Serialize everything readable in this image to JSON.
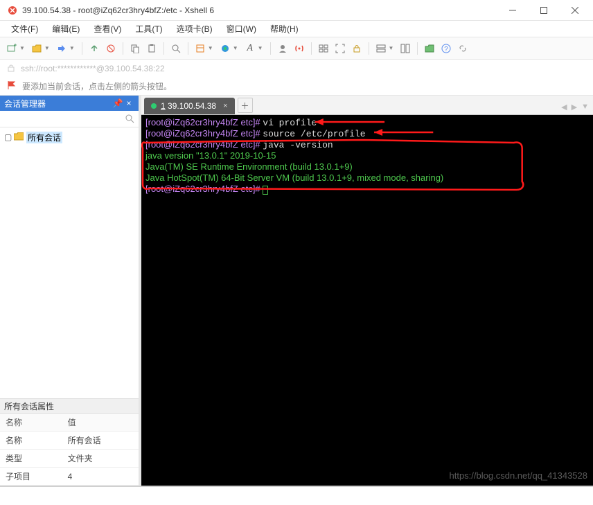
{
  "titlebar": {
    "title": "39.100.54.38 - root@iZq62cr3hry4bfZ:/etc - Xshell 6"
  },
  "menubar": {
    "file": "文件(F)",
    "edit": "编辑(E)",
    "view": "查看(V)",
    "tools": "工具(T)",
    "tabs": "选项卡(B)",
    "window": "窗口(W)",
    "help": "帮助(H)"
  },
  "addressbar": {
    "text": "ssh://root:************@39.100.54.38:22"
  },
  "notify": {
    "text": "要添加当前会话，点击左侧的箭头按钮。"
  },
  "sidebar": {
    "title": "会话管理器",
    "tree": {
      "root_label": "所有会话"
    },
    "props_title": "所有会话属性",
    "props_headers": {
      "name": "名称",
      "value": "值"
    },
    "props_rows": [
      {
        "k": "名称",
        "v": "所有会话"
      },
      {
        "k": "类型",
        "v": "文件夹"
      },
      {
        "k": "子项目",
        "v": "4"
      }
    ]
  },
  "main": {
    "tab": {
      "num": "1",
      "label": "39.100.54.38"
    },
    "terminal": {
      "lines": [
        {
          "prompt": "[root@iZq62cr3hry4bfZ etc]# ",
          "cmd": "vi profile"
        },
        {
          "prompt": "[root@iZq62cr3hry4bfZ etc]# ",
          "cmd": "source /etc/profile"
        },
        {
          "prompt": "[root@iZq62cr3hry4bfZ etc]# ",
          "cmd": "java -version"
        },
        {
          "out": "java version \"13.0.1\" 2019-10-15"
        },
        {
          "out": "Java(TM) SE Runtime Environment (build 13.0.1+9)"
        },
        {
          "out": "Java HotSpot(TM) 64-Bit Server VM (build 13.0.1+9, mixed mode, sharing)"
        },
        {
          "prompt": "[root@iZq62cr3hry4bfZ etc]# ",
          "cursor": true
        }
      ],
      "watermark": "https://blog.csdn.net/qq_41343528"
    }
  }
}
